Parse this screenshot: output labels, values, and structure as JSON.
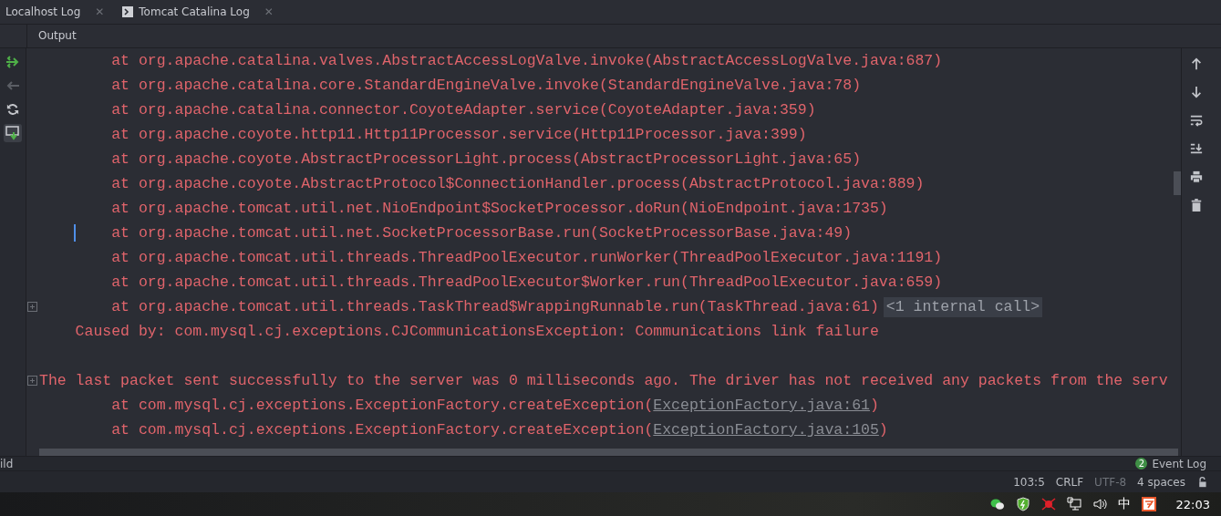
{
  "tabs": [
    {
      "label": "Localhost Log",
      "kind": "plain",
      "close": "✕"
    },
    {
      "label": "Tomcat Catalina Log",
      "kind": "console",
      "close": "✕"
    }
  ],
  "output": {
    "title": "Output"
  },
  "log_lines": [
    {
      "kind": "frame",
      "text": "at org.apache.catalina.valves.AbstractAccessLogValve.invoke(AbstractAccessLogValve.java:687)",
      "folded": false,
      "caret": false
    },
    {
      "kind": "frame",
      "text": "at org.apache.catalina.core.StandardEngineValve.invoke(StandardEngineValve.java:78)",
      "folded": false,
      "caret": false
    },
    {
      "kind": "frame",
      "text": "at org.apache.catalina.connector.CoyoteAdapter.service(CoyoteAdapter.java:359)",
      "folded": false,
      "caret": false
    },
    {
      "kind": "frame",
      "text": "at org.apache.coyote.http11.Http11Processor.service(Http11Processor.java:399)",
      "folded": false,
      "caret": false
    },
    {
      "kind": "frame",
      "text": "at org.apache.coyote.AbstractProcessorLight.process(AbstractProcessorLight.java:65)",
      "folded": false,
      "caret": false
    },
    {
      "kind": "frame",
      "text": "at org.apache.coyote.AbstractProtocol$ConnectionHandler.process(AbstractProtocol.java:889)",
      "folded": false,
      "caret": false
    },
    {
      "kind": "frame",
      "text": "at org.apache.tomcat.util.net.NioEndpoint$SocketProcessor.doRun(NioEndpoint.java:1735)",
      "folded": false,
      "caret": false
    },
    {
      "kind": "frame",
      "text": "at org.apache.tomcat.util.net.SocketProcessorBase.run(SocketProcessorBase.java:49)",
      "folded": false,
      "caret": true
    },
    {
      "kind": "frame",
      "text": "at org.apache.tomcat.util.threads.ThreadPoolExecutor.runWorker(ThreadPoolExecutor.java:1191)",
      "folded": false,
      "caret": false
    },
    {
      "kind": "frame",
      "text": "at org.apache.tomcat.util.threads.ThreadPoolExecutor$Worker.run(ThreadPoolExecutor.java:659)",
      "folded": false,
      "caret": false
    },
    {
      "kind": "frame",
      "text": "at org.apache.tomcat.util.threads.TaskThread$WrappingRunnable.run(TaskThread.java:61)",
      "hint": "<1 internal call>",
      "folded": true,
      "caret": false
    },
    {
      "kind": "cause",
      "text": "Caused by: com.mysql.cj.exceptions.CJCommunicationsException: Communications link failure",
      "folded": false,
      "caret": false
    },
    {
      "kind": "blank"
    },
    {
      "kind": "message",
      "text": "The last packet sent successfully to the server was 0 milliseconds ago. The driver has not received any packets from the serv",
      "folded": true,
      "caret": false
    },
    {
      "kind": "frame",
      "text": "at com.mysql.cj.exceptions.ExceptionFactory.createException(",
      "link": "ExceptionFactory.java:61",
      "suffix": ")",
      "folded": false,
      "caret": false
    },
    {
      "kind": "frame",
      "text": "at com.mysql.cj.exceptions.ExceptionFactory.createException(",
      "link": "ExceptionFactory.java:105",
      "suffix": ")",
      "folded": false,
      "caret": false
    }
  ],
  "tool_window_bar": {
    "left": "ild",
    "event_log": {
      "count": "2",
      "label": "Event Log"
    }
  },
  "status_bar": [
    {
      "text": "103:5",
      "disabled": false
    },
    {
      "text": "CRLF",
      "disabled": false
    },
    {
      "text": "UTF-8",
      "disabled": true
    },
    {
      "text": "4 spaces",
      "disabled": false
    }
  ],
  "taskbar": {
    "ime": "中",
    "clock": "22:03"
  }
}
